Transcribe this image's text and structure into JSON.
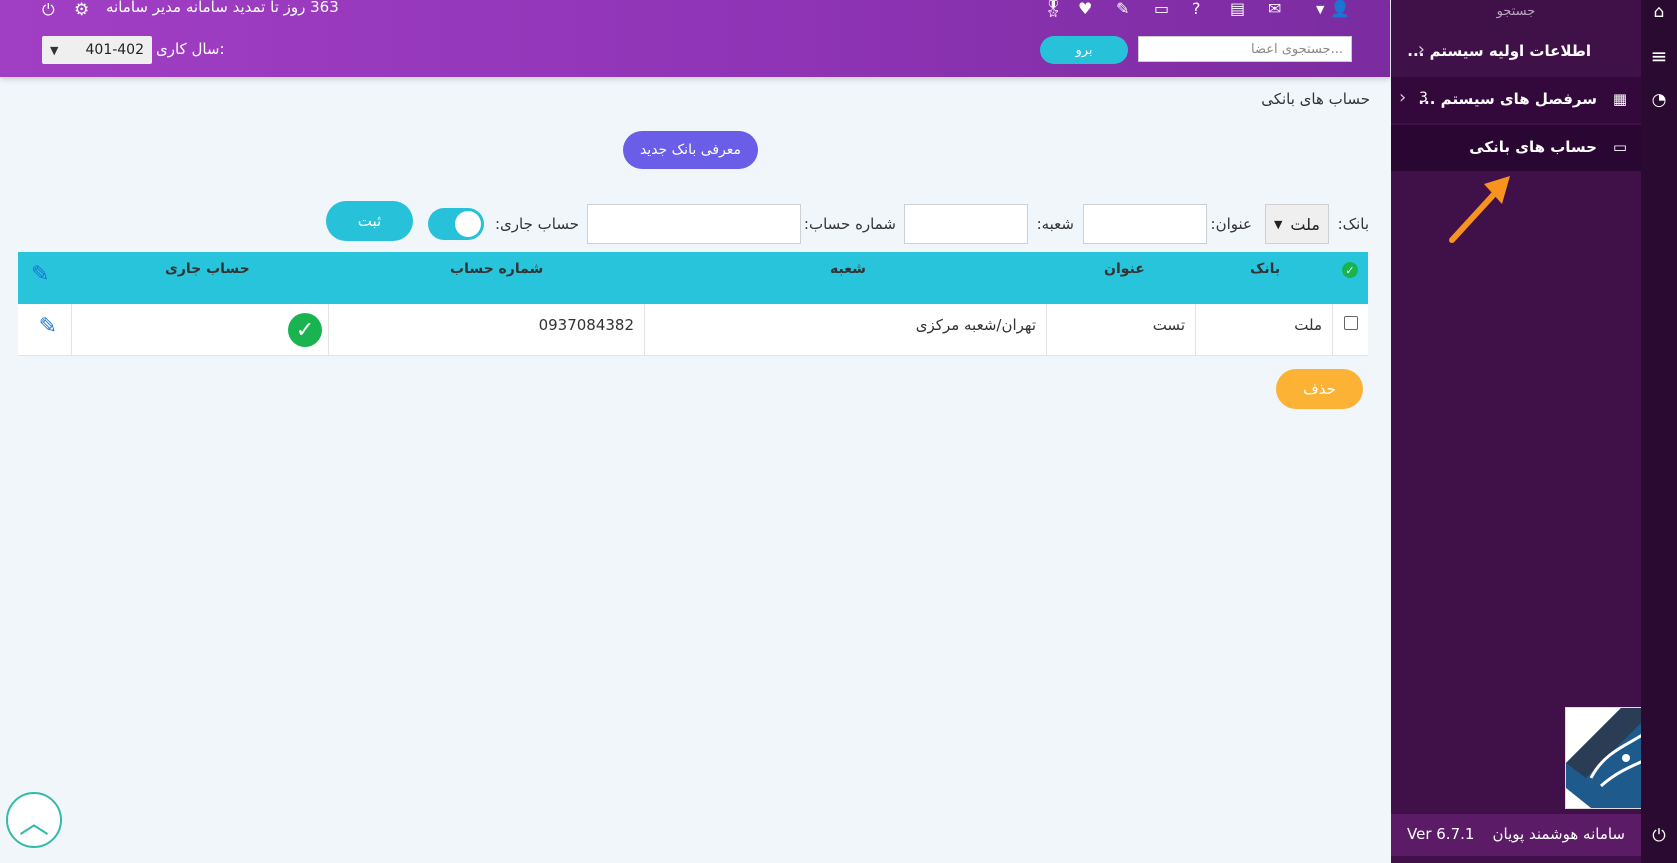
{
  "header": {
    "renew_notice": "363 روز تا تمدید سامانه مدیر سامانه",
    "fiscal_year_label": "سال کاری:",
    "fiscal_year_value": "401-402",
    "member_search_placeholder": "جستجوی اعضا...",
    "go_label": "برو",
    "icons": [
      "user-icon",
      "envelope-icon",
      "folder-icon",
      "help-icon",
      "card-icon",
      "edit-icon",
      "heartbeat-icon",
      "medal-icon",
      "gears-icon",
      "power-icon"
    ]
  },
  "sidebar": {
    "search_label": "جستجو",
    "items": [
      {
        "label": "اطلاعات اولیه سیستم ..."
      },
      {
        "label": "سرفصل های سیستم ...",
        "count": "3"
      },
      {
        "label": "حساب های بانکی"
      }
    ],
    "footer_name": "سامانه هوشمند پویان",
    "footer_version": "Ver 6.7.1"
  },
  "page": {
    "title": "حساب های بانکی",
    "new_bank_button": "معرفی بانک جدید",
    "filters": {
      "bank_label": "بانک:",
      "bank_value": "ملت",
      "title_label": "عنوان:",
      "branch_label": "شعبه:",
      "account_number_label": "شماره حساب:",
      "current_account_label": "حساب جاری:",
      "current_account_on": true,
      "save_button": "ثبت"
    },
    "table": {
      "columns": [
        "بانک",
        "عنوان",
        "شعبه",
        "شماره حساب",
        "حساب جاری"
      ],
      "rows": [
        {
          "bank": "ملت",
          "title": "تست",
          "branch": "تهران/شعبه مرکزی",
          "account_number": "0937084382",
          "current_account": true
        }
      ]
    },
    "delete_button": "حذف"
  },
  "colors": {
    "header_start": "#a13fc4",
    "header_end": "#7b2ca0",
    "sidebar": "#3f1148",
    "teal": "#28c4dc",
    "new_bank_button": "#6a5de8",
    "delete_button": "#fbb235",
    "success": "#19b34f"
  }
}
